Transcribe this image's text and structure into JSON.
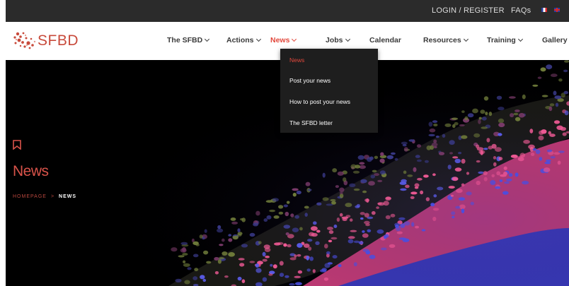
{
  "topbar": {
    "login_label": "LOGIN / REGISTER",
    "faq_label": "FAQs",
    "lang_fr": "fr-flag",
    "lang_en": "uk-flag"
  },
  "brand": {
    "name": "SFBD",
    "color": "#c84a3b",
    "logo_icon": "sfbd-logo-icon"
  },
  "nav": {
    "items": [
      {
        "label": "The SFBD",
        "dropdown": true
      },
      {
        "label": "Actions",
        "dropdown": true
      },
      {
        "label": "News",
        "dropdown": true,
        "active": true
      },
      {
        "label": "Jobs",
        "dropdown": true
      },
      {
        "label": "Calendar",
        "dropdown": false
      },
      {
        "label": "Resources",
        "dropdown": true
      },
      {
        "label": "Training",
        "dropdown": true
      },
      {
        "label": "Gallery",
        "dropdown": false
      }
    ],
    "active_color": "#e2483c"
  },
  "news_menu": {
    "items": [
      {
        "label": "News",
        "active": true
      },
      {
        "label": "Post your news"
      },
      {
        "label": "How to post your news"
      },
      {
        "label": "The SFBD letter"
      }
    ]
  },
  "hero": {
    "icon": "bookmark-icon",
    "title": "News",
    "breadcrumb": {
      "home": "HOMEPAGE",
      "separator": ">",
      "current": "NEWS"
    }
  }
}
